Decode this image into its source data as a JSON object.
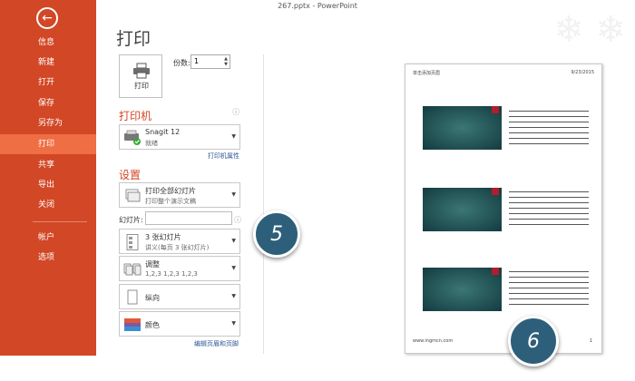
{
  "window": {
    "title": "267.pptx - PowerPoint"
  },
  "sidebar": {
    "back_icon": "arrow-left-icon",
    "items": [
      {
        "label": "信息"
      },
      {
        "label": "新建"
      },
      {
        "label": "打开"
      },
      {
        "label": "保存"
      },
      {
        "label": "另存为"
      },
      {
        "label": "打印",
        "active": true
      },
      {
        "label": "共享"
      },
      {
        "label": "导出"
      },
      {
        "label": "关闭"
      },
      {
        "label": "帐户"
      },
      {
        "label": "选项"
      }
    ],
    "bg_color": "#d24726",
    "active_color": "#ef6e44"
  },
  "print": {
    "title": "打印",
    "button_label": "打印",
    "copies_label": "份数:",
    "copies_value": "1"
  },
  "printer": {
    "heading": "打印机",
    "name": "Snagit 12",
    "status": "就绪",
    "properties_link": "打印机属性"
  },
  "settings": {
    "heading": "设置",
    "range": {
      "l1": "打印全部幻灯片",
      "l2": "打印整个演示文稿"
    },
    "slides_label": "幻灯片:",
    "slides_value": "",
    "layout": {
      "l1": "3 张幻灯片",
      "l2": "讲义(每页 3 张幻灯片)"
    },
    "collate": {
      "l1": "调整",
      "l2": "1,2,3    1,2,3    1,2,3"
    },
    "orientation": {
      "l1": "纵向"
    },
    "color": {
      "l1": "颜色"
    },
    "header_footer_link": "编辑页眉和页脚"
  },
  "callouts": {
    "c1": "5",
    "c2": "6"
  },
  "preview": {
    "header_left": "单击添加页眉",
    "header_date": "9/23/2015",
    "footer_left": "www.ingmcn.com",
    "page_number": "1"
  }
}
